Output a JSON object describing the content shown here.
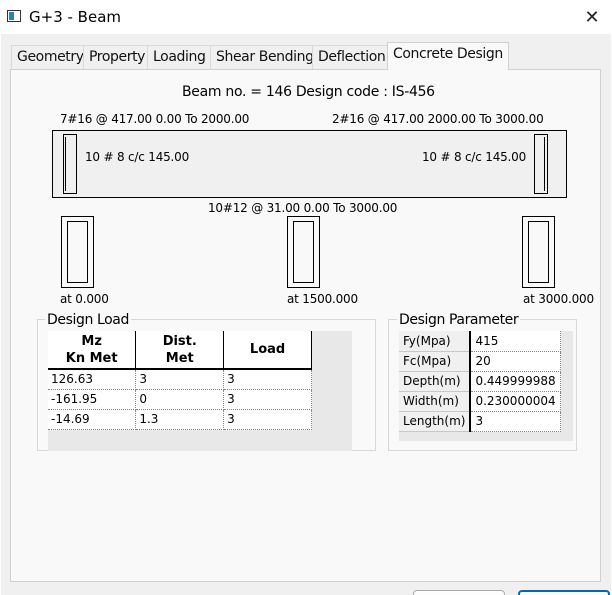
{
  "window": {
    "title": "G+3 - Beam",
    "icon": "app-window-icon",
    "close_glyph": "✕"
  },
  "tabs": [
    {
      "label": "Geometry",
      "active": false
    },
    {
      "label": "Property",
      "active": false
    },
    {
      "label": "Loading",
      "active": false
    },
    {
      "label": "Shear Bending",
      "active": false
    },
    {
      "label": "Deflection",
      "active": false
    },
    {
      "label": "Concrete Design",
      "active": true
    }
  ],
  "beam": {
    "header": "Beam no. = 146  Design code :  IS-456",
    "top_left_reinf": "7#16 @ 417.00 0.00 To 2000.00",
    "top_right_reinf": "2#16 @ 417.00 2000.00 To 3000.00",
    "stirrup_left": "10 # 8 c/c 145.00",
    "stirrup_right": "10 # 8 c/c 145.00",
    "bottom_reinf": "10#12 @ 31.00 0.00 To 3000.00",
    "sections": [
      {
        "label": "at 0.000"
      },
      {
        "label": "at 1500.000"
      },
      {
        "label": "at 3000.000"
      }
    ]
  },
  "design_load": {
    "title": "Design Load",
    "columns": [
      "Mz\nKn Met",
      "Dist.\nMet",
      "Load"
    ],
    "column_lines": [
      [
        "Mz",
        "Kn Met"
      ],
      [
        "Dist.",
        "Met"
      ],
      [
        "Load"
      ]
    ],
    "rows": [
      [
        "126.63",
        "3",
        "3"
      ],
      [
        "-161.95",
        "0",
        "3"
      ],
      [
        "-14.69",
        "1.3",
        "3"
      ]
    ]
  },
  "design_parameter": {
    "title": "Design Parameter",
    "rows": [
      {
        "key": "Fy(Mpa)",
        "value": "415"
      },
      {
        "key": "Fc(Mpa)",
        "value": "20"
      },
      {
        "key": "Depth(m)",
        "value": "0.449999988"
      },
      {
        "key": "Width(m)",
        "value": "0.230000004"
      },
      {
        "key": "Length(m)",
        "value": "3"
      }
    ]
  }
}
